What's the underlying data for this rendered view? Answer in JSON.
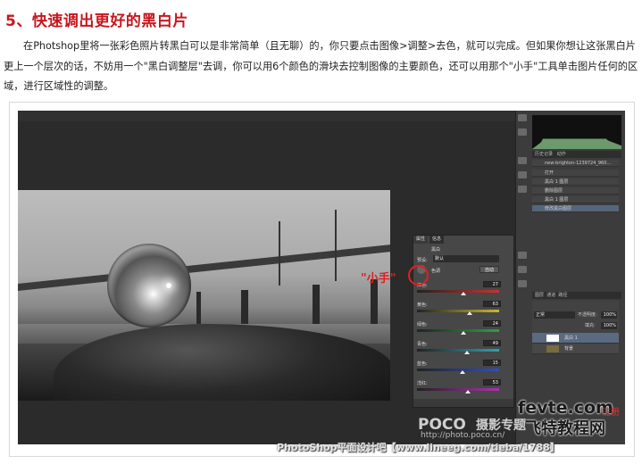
{
  "heading": "5、快速调出更好的黑白片",
  "paragraph": "在Photshop里将一张彩色照片转黑白可以是非常简单（且无聊）的，你只要点击图像>调整>去色，就可以完成。但如果你想让这张黑白片更上一个层次的话，不妨用一个\"黑白调整层\"去调，你可以用6个颜色的滑块去控制图像的主要颜色，还可以用那个\"小手\"工具单击图片任何的区域，进行区域性的调整。",
  "screenshot": {
    "history_panel": {
      "tabs": [
        "历史记录",
        "动作"
      ],
      "snapshot": "new-brighton-1239724_960...",
      "items": [
        {
          "label": "打开",
          "active": false
        },
        {
          "label": "黑白 1 图层",
          "active": false
        },
        {
          "label": "删除图层",
          "active": false
        },
        {
          "label": "黑白 1 图层",
          "active": false
        },
        {
          "label": "修改黑白图层",
          "active": true
        }
      ]
    },
    "layers_panel": {
      "tabs": [
        "图层",
        "通道",
        "路径"
      ],
      "blend_mode": "正常",
      "opacity_label": "不透明度:",
      "opacity": "100%",
      "fill_label": "填充:",
      "fill": "100%",
      "layers": [
        {
          "label": "黑白 1",
          "active": true
        },
        {
          "label": "背景",
          "active": false
        }
      ]
    },
    "adjust_panel": {
      "tabs": [
        "属性",
        "信息"
      ],
      "title": "黑白",
      "preset_label": "预设:",
      "preset_value": "默认",
      "tint_label": "色调",
      "auto_label": "自动",
      "sliders": [
        {
          "label": "红色:",
          "value": "27",
          "color": "#d03030",
          "fraction": 0.57
        },
        {
          "label": "黄色:",
          "value": "63",
          "color": "#c8b830",
          "fraction": 0.64
        },
        {
          "label": "绿色:",
          "value": "24",
          "color": "#30a040",
          "fraction": 0.57
        },
        {
          "label": "青色:",
          "value": "49",
          "color": "#30a0b0",
          "fraction": 0.61
        },
        {
          "label": "蓝色:",
          "value": "15",
          "color": "#3050c0",
          "fraction": 0.55
        },
        {
          "label": "洋红:",
          "value": "53",
          "color": "#b030b0",
          "fraction": 0.62
        }
      ]
    },
    "annotation": "\"小手\""
  },
  "watermarks": {
    "poco": "POCO",
    "poco_sub": "摄影专题",
    "poco_url": "http://photo.poco.cn/",
    "fevte": "fevte.com",
    "fevte_cn": "飞特教程网",
    "fevte_tag": "注册",
    "footer": "PhotoShop平面设计吧【www.lineeg.com/tieba/1788】"
  },
  "colors": {
    "heading": "#c8161d",
    "annotation": "#e02020"
  }
}
